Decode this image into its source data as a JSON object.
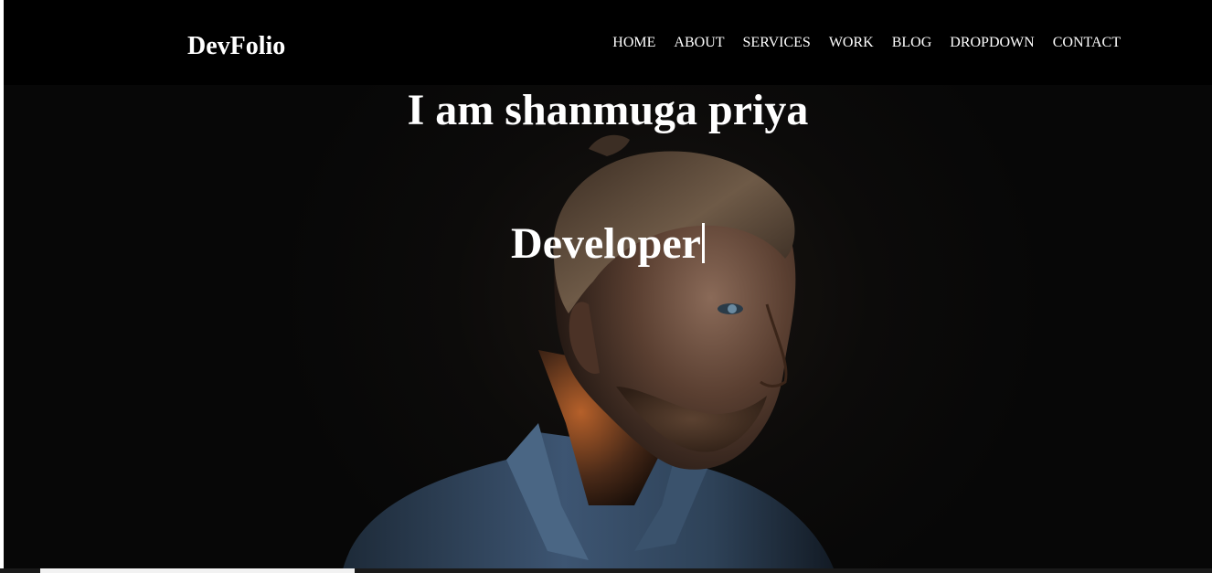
{
  "brand": {
    "name": "DevFolio"
  },
  "nav": {
    "items": [
      {
        "label": "HOME"
      },
      {
        "label": "ABOUT"
      },
      {
        "label": "SERVICES"
      },
      {
        "label": "WORK"
      },
      {
        "label": "BLOG"
      },
      {
        "label": "DROPDOWN"
      },
      {
        "label": "CONTACT"
      }
    ]
  },
  "hero": {
    "title": "I am shanmuga priya",
    "typed_text": "Developer",
    "background_image": "portrait-photo"
  },
  "colors": {
    "background": "#000000",
    "text": "#ffffff"
  }
}
